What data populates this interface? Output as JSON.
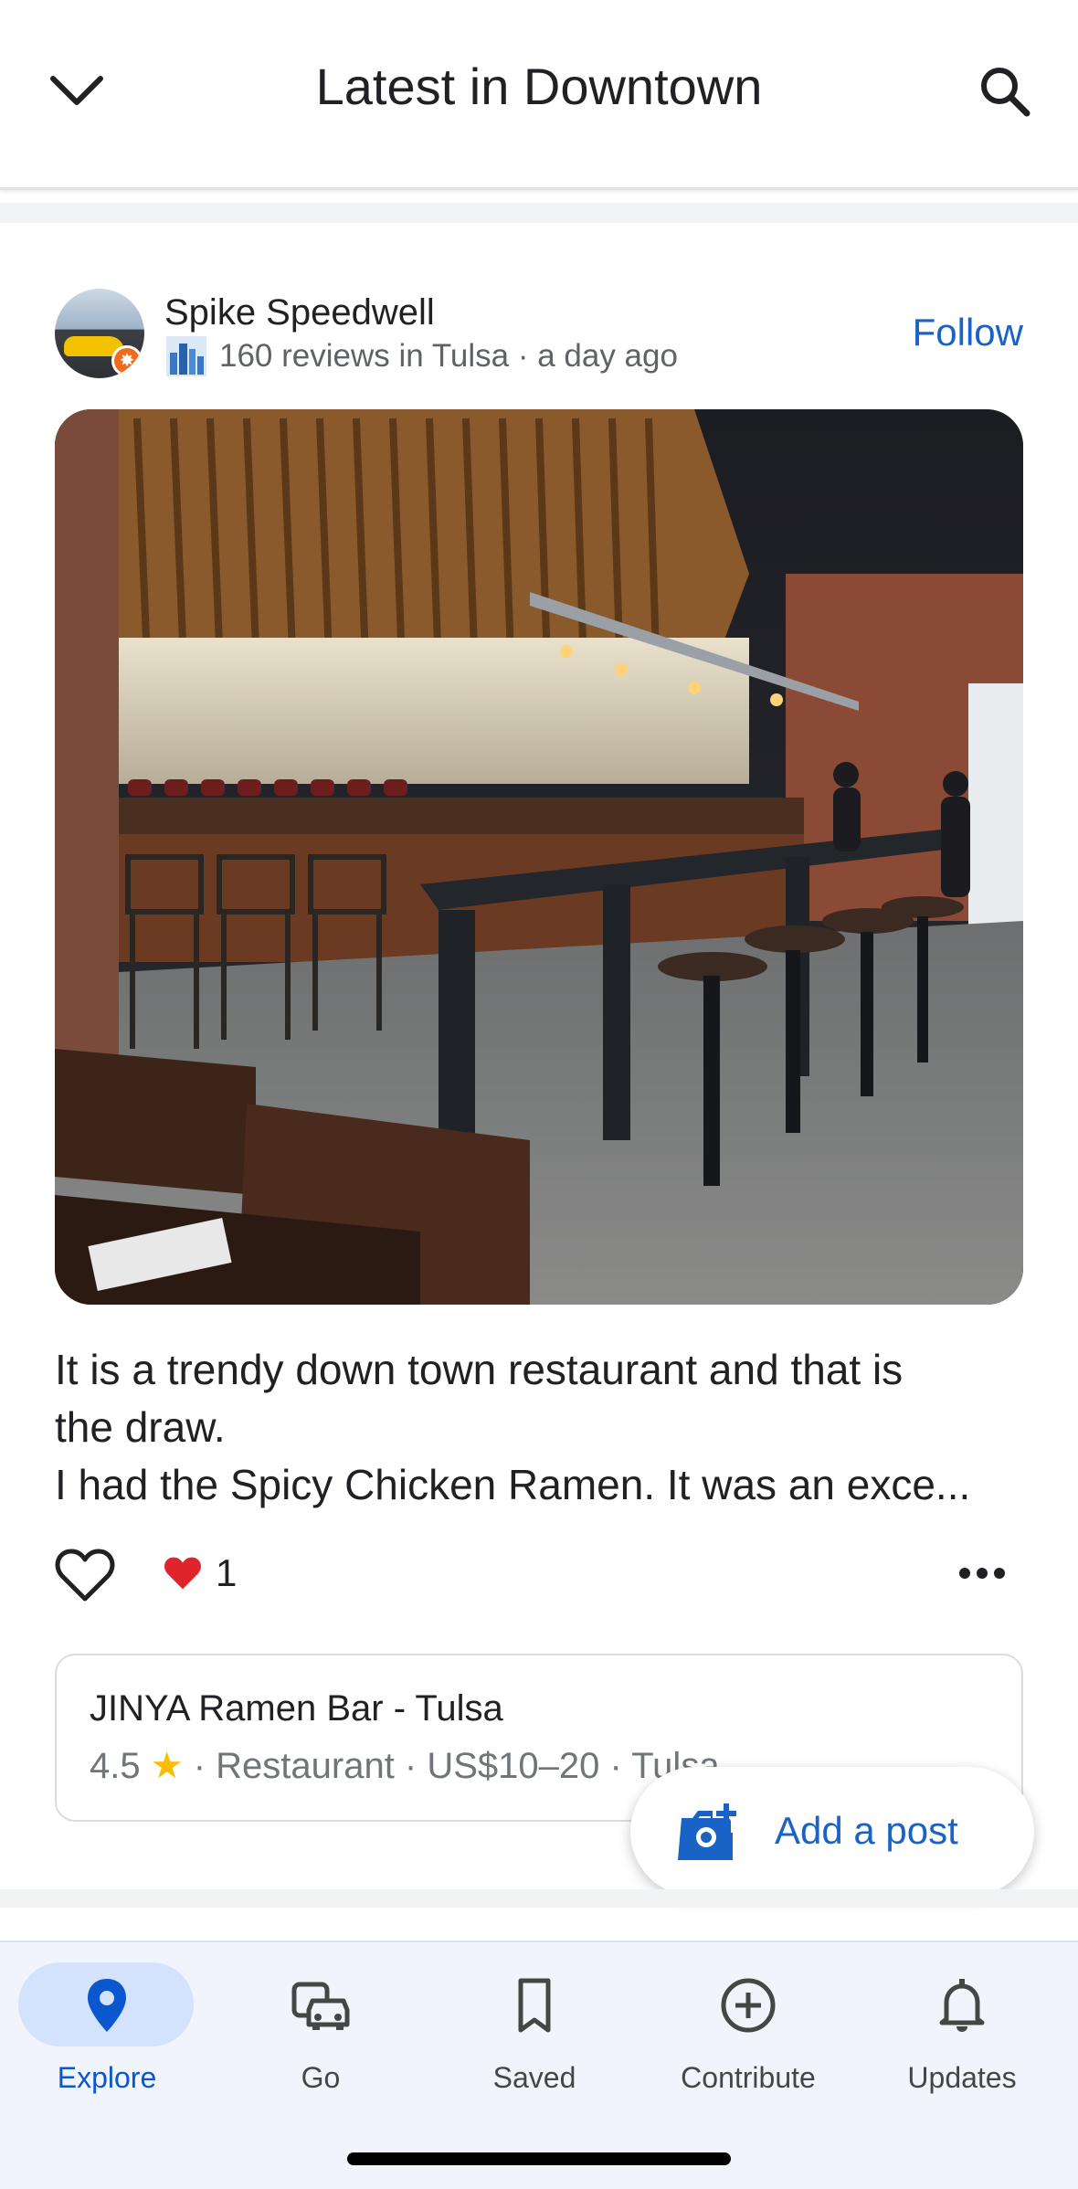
{
  "header": {
    "title": "Latest in Downtown",
    "back_icon": "chevron-down-icon",
    "search_icon": "search-icon"
  },
  "post": {
    "author": {
      "name": "Spike Speedwell",
      "meta": "160 reviews in Tulsa · a day ago",
      "badge_icon": "local-guide-badge-icon",
      "city_icon": "city-skyline-icon"
    },
    "follow_label": "Follow",
    "text_lines": [
      "It is a trendy down town restaurant and that is",
      "the draw.",
      "I had the Spicy Chicken Ramen.  It was an exce..."
    ],
    "reaction_count": "1",
    "place": {
      "name": "JINYA Ramen Bar - Tulsa",
      "rating": "4.5",
      "meta": "· Restaurant · US$10–20 · Tulsa"
    }
  },
  "fab": {
    "label": "Add a post"
  },
  "nav": {
    "items": [
      {
        "label": "Explore",
        "icon": "location-pin-icon",
        "active": true
      },
      {
        "label": "Go",
        "icon": "commute-icon",
        "active": false
      },
      {
        "label": "Saved",
        "icon": "bookmark-icon",
        "active": false
      },
      {
        "label": "Contribute",
        "icon": "add-circle-icon",
        "active": false
      },
      {
        "label": "Updates",
        "icon": "bell-icon",
        "active": false
      }
    ]
  },
  "colors": {
    "accent": "#1a63c6",
    "nav_active": "#0b57d0",
    "nav_active_pill": "#d3e3fd",
    "star": "#fbbc04",
    "heart": "#e0242c"
  }
}
